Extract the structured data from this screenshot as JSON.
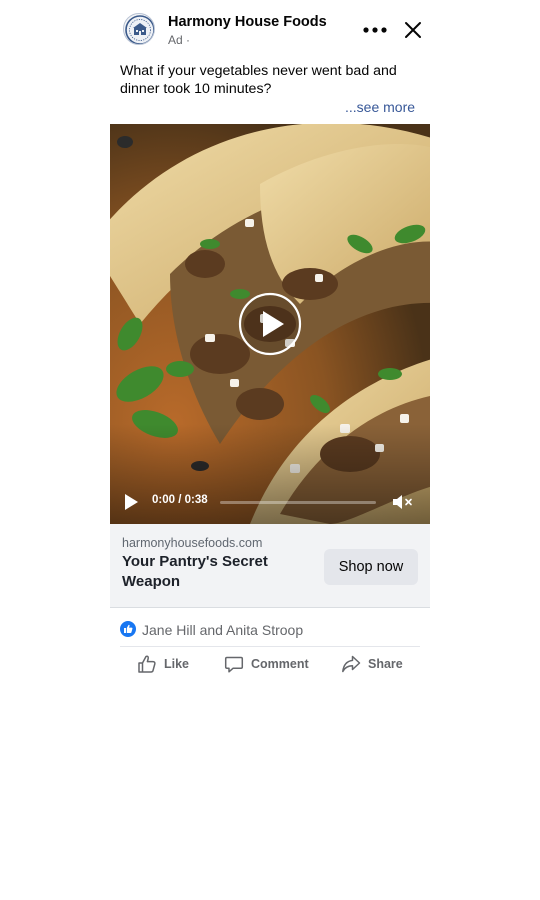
{
  "post": {
    "page_name": "Harmony House Foods",
    "sponsored": "Ad ·",
    "text": "What if your vegetables never went bad and dinner took 10 minutes?",
    "see_more": "...see more"
  },
  "video": {
    "current_time": "0:00 / 0:38",
    "progress": 0,
    "icons": {
      "play_overlay": "play-icon",
      "control_play": "play-icon",
      "volume": "muted-speaker-icon"
    }
  },
  "link_card": {
    "domain": "harmonyhousefoods.com",
    "headline": "Your Pantry's Secret Weapon",
    "cta_label": "Shop now"
  },
  "reactions": {
    "names": "Jane Hill and Anita Stroop",
    "icon": "thumbs-up-icon"
  },
  "actions": [
    {
      "label": "Like",
      "icon": "thumbs-up-icon"
    },
    {
      "label": "Comment",
      "icon": "comment-icon"
    },
    {
      "label": "Share",
      "icon": "share-icon"
    }
  ],
  "colors": {
    "link_blue": "#385898",
    "brand_blue": "#1877f2",
    "secondary_text": "#65676b",
    "card_bg": "#f2f3f5",
    "button_bg": "#e4e6eb"
  }
}
